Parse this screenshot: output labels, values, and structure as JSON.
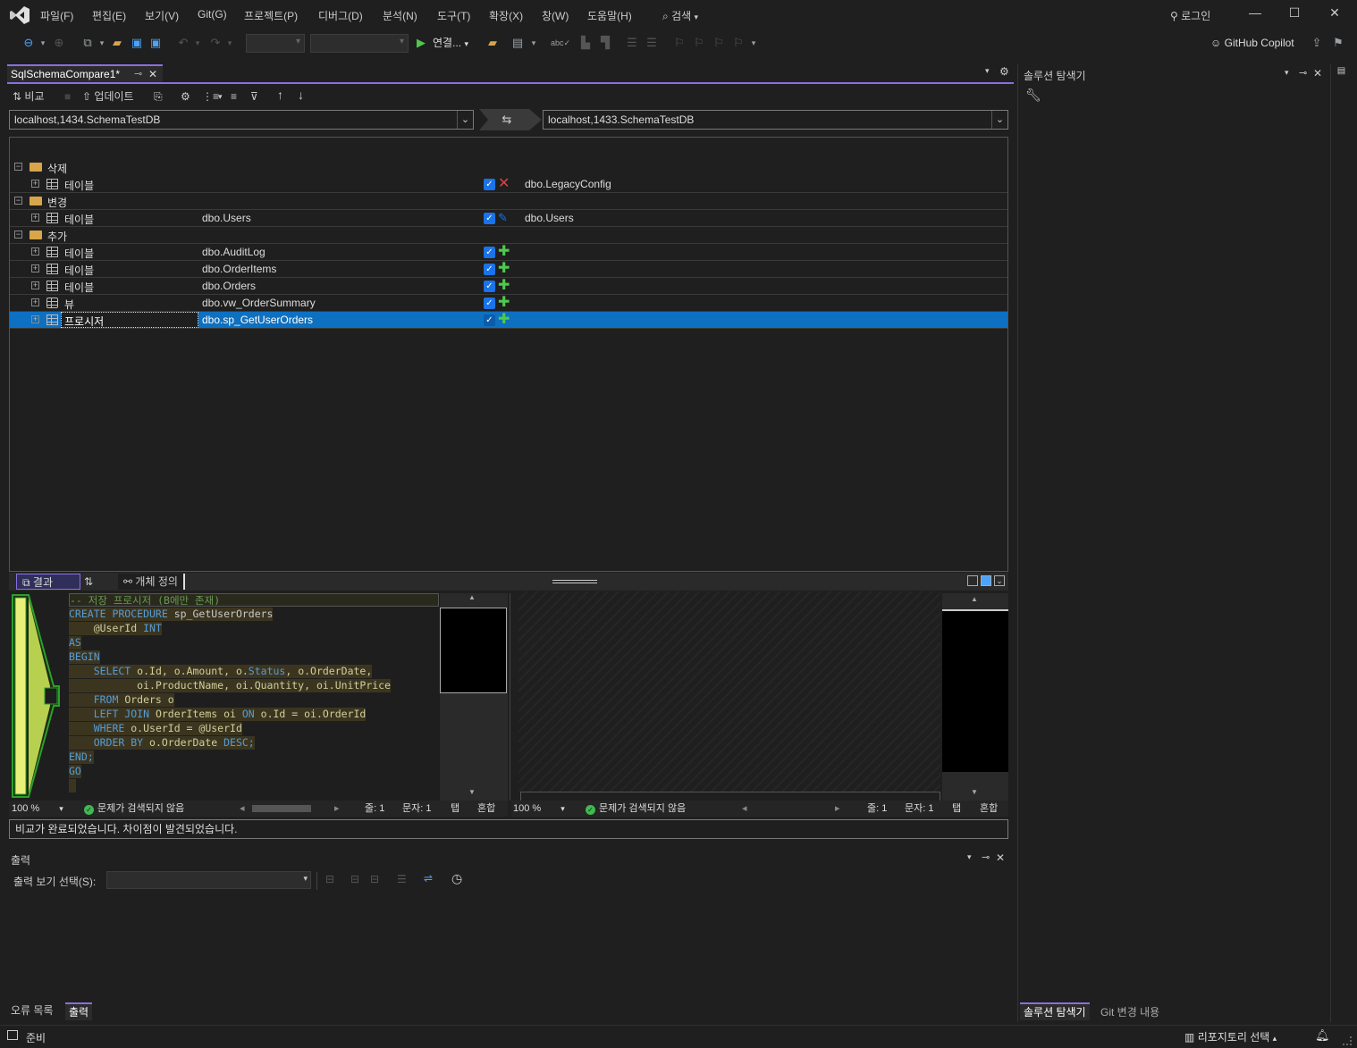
{
  "menu": {
    "items": [
      "파일(F)",
      "편집(E)",
      "보기(V)",
      "Git(G)",
      "프로젝트(P)",
      "디버그(D)",
      "분석(N)",
      "도구(T)",
      "확장(X)",
      "창(W)",
      "도움말(H)"
    ],
    "search": "검색",
    "login": "로그인"
  },
  "toolbar": {
    "connect_label": "연결...",
    "copilot_label": "GitHub Copilot"
  },
  "document": {
    "tab_title": "SqlSchemaCompare1*"
  },
  "compare_toolbar": {
    "compare_label": "비교",
    "update_label": "업데이트"
  },
  "source": {
    "connection": "localhost,1434.SchemaTestDB"
  },
  "target": {
    "connection": "localhost,1433.SchemaTestDB"
  },
  "groups": {
    "delete": "삭제",
    "change": "변경",
    "add": "추가"
  },
  "rows": [
    {
      "type": "테이블",
      "source": "",
      "target": "dbo.LegacyConfig",
      "action": "delete"
    },
    {
      "type": "테이블",
      "source": "dbo.Users",
      "target": "dbo.Users",
      "action": "change"
    },
    {
      "type": "테이블",
      "source": "dbo.AuditLog",
      "target": "",
      "action": "add"
    },
    {
      "type": "테이블",
      "source": "dbo.OrderItems",
      "target": "",
      "action": "add"
    },
    {
      "type": "테이블",
      "source": "dbo.Orders",
      "target": "",
      "action": "add"
    },
    {
      "type": "뷰",
      "source": "dbo.vw_OrderSummary",
      "target": "",
      "action": "add"
    },
    {
      "type": "프로시저",
      "source": "dbo.sp_GetUserOrders",
      "target": "",
      "action": "add"
    }
  ],
  "diff_tabs": {
    "results": "결과",
    "definition": "개체 정의"
  },
  "code": {
    "l0": "-- 저장 프로시저 (B에만 존재)",
    "l1a": "CREATE PROCEDURE ",
    "l1b": "sp_GetUserOrders",
    "l2a": "    @UserId ",
    "l2b": "INT",
    "l3": "AS",
    "l4": "BEGIN",
    "l5a": "    SELECT ",
    "l5b": "o.Id, o.Amount, o.",
    "l5c": "Status",
    "l5d": ", o.OrderDate,",
    "l6": "           oi.ProductName, oi.Quantity, oi.UnitPrice",
    "l7a": "    FROM ",
    "l7b": "Orders o",
    "l8a": "    LEFT JOIN ",
    "l8b": "OrderItems oi ",
    "l8c": "ON ",
    "l8d": "o.Id = oi.OrderId",
    "l9a": "    WHERE ",
    "l9b": "o.UserId = @UserId",
    "l10a": "    ORDER BY ",
    "l10b": "o.OrderDate ",
    "l10c": "DESC;",
    "l11": "END;",
    "l12": "GO"
  },
  "editor_status": {
    "zoom": "100 %",
    "issues": "문제가 검색되지 않음",
    "line": "줄: 1",
    "char": "문자: 1",
    "tab": "탭",
    "mixed": "혼합"
  },
  "compare_status": "비교가 완료되었습니다. 차이점이 발견되었습니다.",
  "output": {
    "title": "출력",
    "select_label": "출력 보기 선택(S):"
  },
  "bottom_tabs": [
    "오류 목록",
    "출력"
  ],
  "solution_explorer": {
    "title": "솔루션 탐색기",
    "tabs": [
      "솔루션 탐색기",
      "Git 변경 내용"
    ]
  },
  "statusbar": {
    "ready": "준비",
    "repo": "리포지토리 선택"
  },
  "colors": {
    "accent": "#8a6ee0",
    "selection": "#0e70c0",
    "add": "#4ec94e",
    "delete": "#e04040",
    "change": "#1a73e8"
  }
}
